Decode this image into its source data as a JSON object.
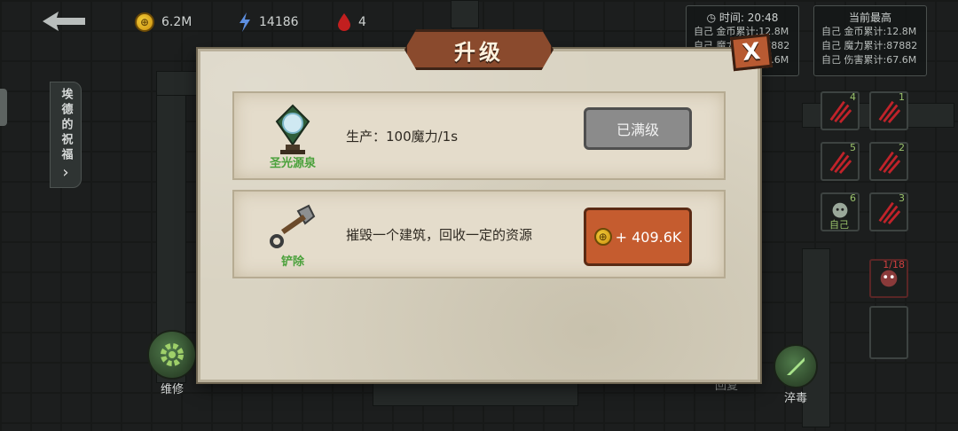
{
  "hud": {
    "gold": "6.2M",
    "energy": "14186",
    "blood": "4"
  },
  "self_panel": {
    "time": "时间: 20:48",
    "rows": [
      "自己 金币累计:12.8M",
      "自己 魔力累计:87882",
      "自己 伤害累计:67.6M"
    ]
  },
  "best_panel": {
    "title": "当前最高",
    "rows": [
      "自己 金币累计:12.8M",
      "自己 魔力累计:87882",
      "自己 伤害累计:67.6M"
    ]
  },
  "side_tab": {
    "label": "埃德的祝福",
    "arrow": "›"
  },
  "skills": [
    {
      "num": "4"
    },
    {
      "num": "1"
    },
    {
      "num": "5"
    },
    {
      "num": "2"
    },
    {
      "num": "6",
      "label": "自己"
    },
    {
      "num": "3"
    }
  ],
  "enemy_badge": "1/18",
  "bottom": {
    "repair": "维修",
    "restore": "回复",
    "poison": "淬毒"
  },
  "dialog": {
    "title": "升级",
    "close": "X",
    "cards": [
      {
        "name": "圣光源泉",
        "icon": "crystal-fountain-icon",
        "desc": "生产：100魔力/1s",
        "button": "已满级"
      },
      {
        "name": "铲除",
        "icon": "shovel-icon",
        "desc": "摧毁一个建筑，回收一定的资源",
        "button": "+ 409.6K"
      }
    ]
  }
}
